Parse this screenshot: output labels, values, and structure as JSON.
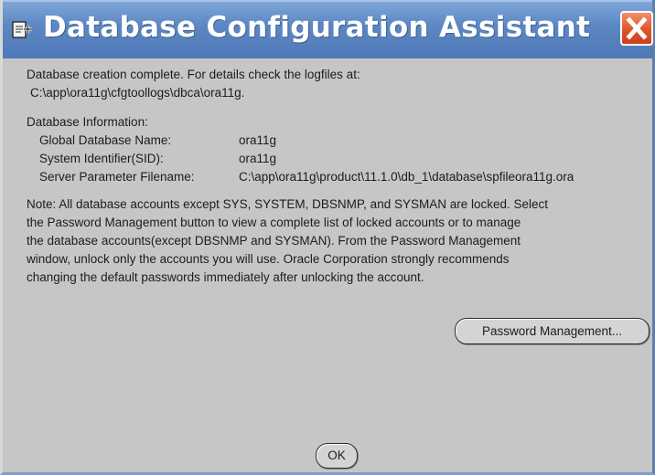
{
  "window": {
    "title": "Database Configuration Assistant"
  },
  "message": {
    "complete_line": "Database creation complete. For details check the logfiles at:",
    "logfile_path": "C:\\app\\ora11g\\cfgtoollogs\\dbca\\ora11g.",
    "info_heading": "Database Information:",
    "info": [
      {
        "label": "Global Database Name:",
        "value": "ora11g"
      },
      {
        "label": "System Identifier(SID):",
        "value": "ora11g"
      },
      {
        "label": "Server Parameter Filename:",
        "value": "C:\\app\\ora11g\\product\\11.1.0\\db_1\\database\\spfileora11g.ora"
      }
    ],
    "note_lines": [
      "Note: All database accounts except SYS, SYSTEM, DBSNMP, and SYSMAN are locked. Select",
      "the Password Management button to view a complete list of locked accounts or to manage",
      "the database accounts(except DBSNMP and SYSMAN). From the Password Management",
      "window, unlock only the accounts you will use. Oracle Corporation strongly recommends",
      "changing the default passwords immediately after unlocking the account."
    ]
  },
  "buttons": {
    "password_management": "Password Management...",
    "ok": "OK"
  },
  "icons": {
    "window_icon": "dbca-app-icon",
    "close": "close-icon"
  },
  "colors": {
    "titlebar": "#5d88c4",
    "close": "#e0542a",
    "background": "#c6c6c6"
  }
}
